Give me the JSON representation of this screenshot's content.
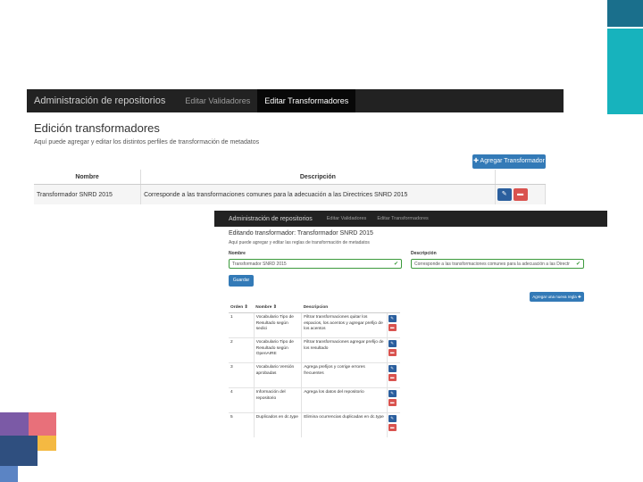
{
  "screen1": {
    "navbar": {
      "brand": "Administración de repositorios",
      "items": [
        {
          "label": "Editar Validadores",
          "active": false
        },
        {
          "label": "Editar Transformadores",
          "active": true
        }
      ]
    },
    "title": "Edición transformadores",
    "subtitle": "Aquí puede agregar y editar los distintos perfiles de transformación de metadatos",
    "add_button": "Agregar Transformador",
    "table": {
      "headers": [
        "Nombre",
        "Descripción"
      ],
      "rows": [
        {
          "nombre": "Transformador SNRD 2015",
          "descripcion": "Corresponde a las transformaciones comunes para la adecuación a las Directrices SNRD 2015"
        }
      ]
    }
  },
  "screen2": {
    "navbar": {
      "brand": "Administración de repositorios",
      "items": [
        {
          "label": "Editar Validadores"
        },
        {
          "label": "Editar Transformadores"
        }
      ]
    },
    "title": "Editando transformador: Transformador SNRD 2015",
    "subtitle": "Aquí puede agregar y editar las reglas de transformación de metadatos",
    "form": {
      "nombre_label": "Nombre",
      "nombre_value": "Transformador SNRD 2015",
      "descripcion_label": "Descripción",
      "descripcion_value": "Corresponde a las transformaciones comunes para la adecuación a las Directr"
    },
    "save_button": "Guardar",
    "add_rule_button": "Agregar una nueva regla",
    "table": {
      "headers": [
        "Orden",
        "Nombre",
        "Descripcion"
      ],
      "rows": [
        {
          "orden": "1",
          "nombre": "Vocabulario Tipo de Resultado según sedici",
          "descripcion": "Filtrar transformaciones quitar los espacios, los acentos y agregar prefijo de los acentos"
        },
        {
          "orden": "2",
          "nombre": "Vocabulario Tipo de Resultado según OpenAIRE",
          "descripcion": "Filtrar transformaciones agregar prefijo de los resultado"
        },
        {
          "orden": "3",
          "nombre": "Vocabulario Versión aprobadas",
          "descripcion": "Agrega prefijos y corrige errores frecuentes"
        },
        {
          "orden": "4",
          "nombre": "Información del repositorio",
          "descripcion": "Agrega los datos del repositorio"
        },
        {
          "orden": "5",
          "nombre": "Duplicados en dc.type",
          "descripcion": "Elimina ocurrencias duplicadas en dc.type"
        }
      ]
    }
  },
  "colors": {
    "navbar_bg": "#222222",
    "primary": "#337ab7",
    "danger": "#d9534f",
    "success": "#3c9a3c",
    "accent_teal": "#17b3bd"
  },
  "icons": {
    "add": "plus-icon",
    "edit": "pencil-icon",
    "delete": "trash-icon",
    "valid": "check-icon",
    "sort": "sort-icon"
  }
}
